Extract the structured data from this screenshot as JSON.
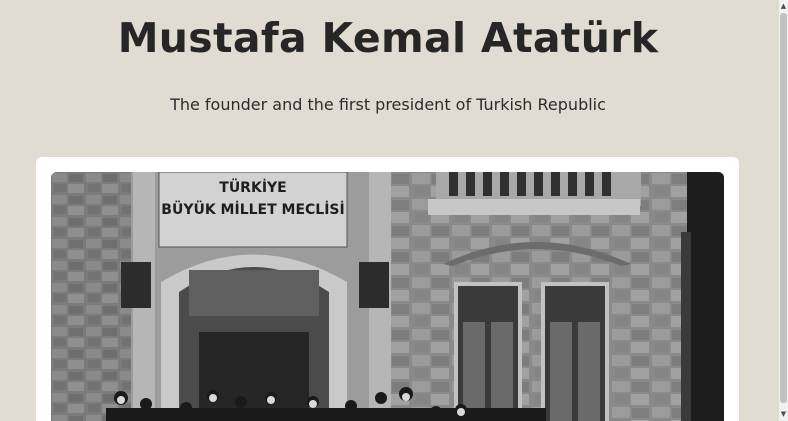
{
  "page": {
    "title": "Mustafa Kemal Atatürk",
    "subtitle": "The founder and the first president of Turkish Republic"
  },
  "photo": {
    "sign_line1": "TÜRKİYE",
    "sign_line2": "BÜYÜK MİLLET MECLİSİ"
  },
  "scrollbar": {
    "up_icon": "▲",
    "down_icon": "▼"
  }
}
